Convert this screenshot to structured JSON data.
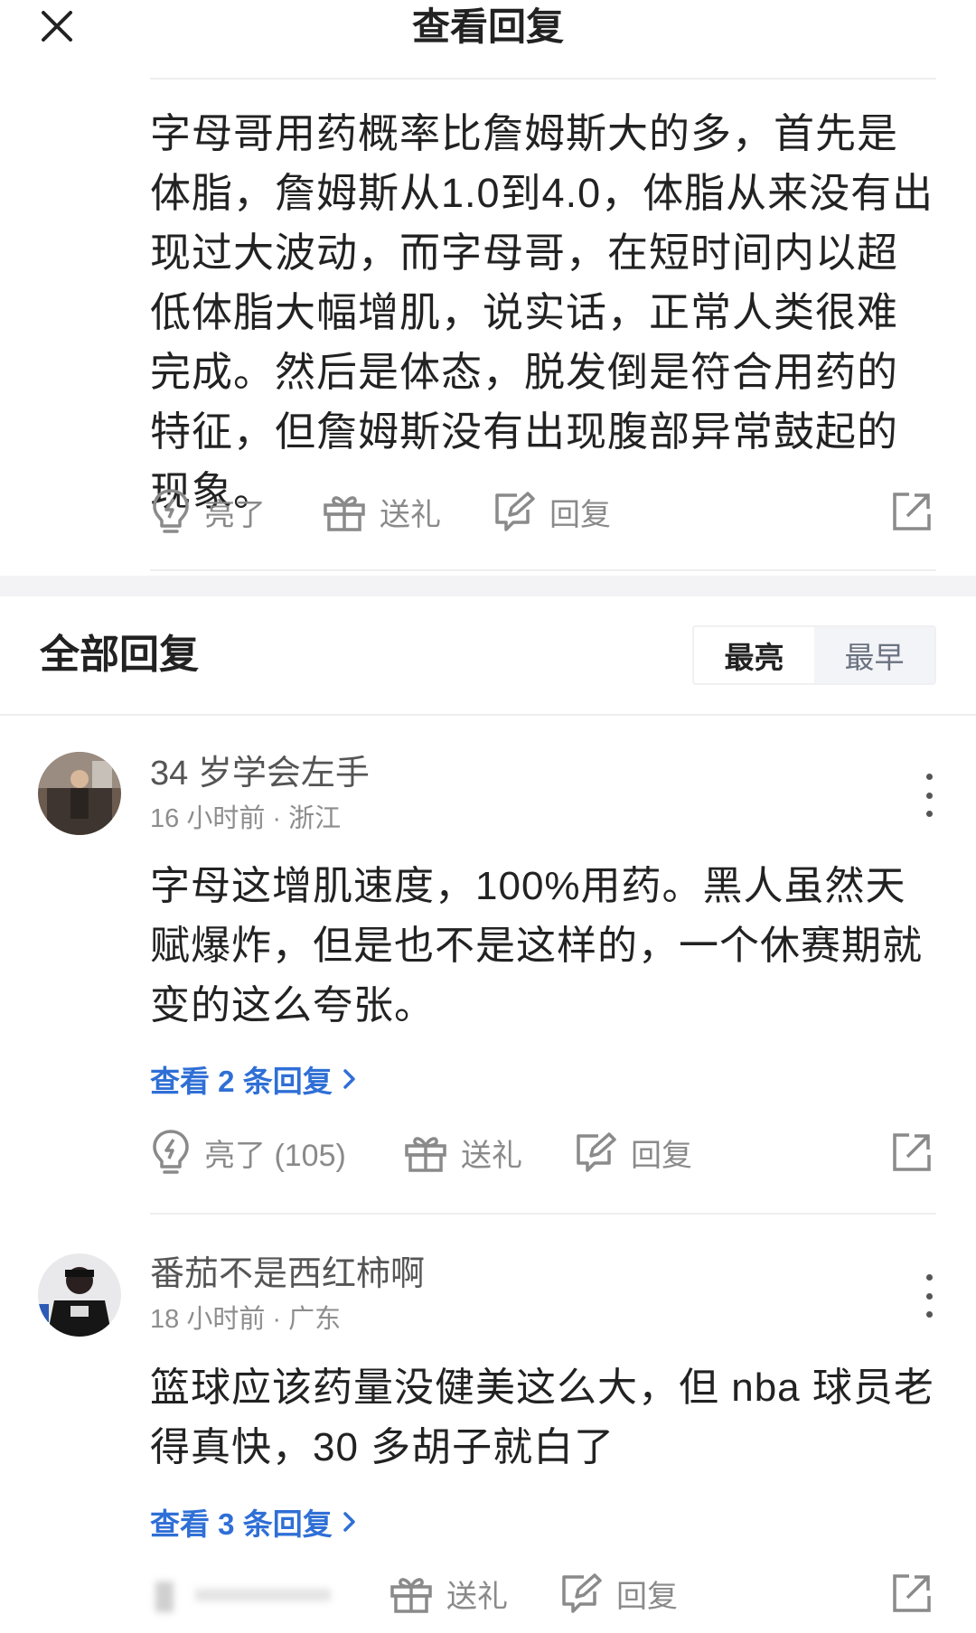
{
  "header": {
    "title": "查看回复"
  },
  "original": {
    "text": "字母哥用药概率比詹姆斯大的多，首先是体脂，詹姆斯从1.0到4.0，体脂从来没有出现过大波动，而字母哥，在短时间内以超低体脂大幅增肌，说实话，正常人类很难完成。然后是体态，脱发倒是符合用药的特征，但詹姆斯没有出现腹部异常鼓起的现象。",
    "actions": {
      "like": "亮了",
      "gift": "送礼",
      "reply": "回复"
    }
  },
  "replies_section": {
    "title": "全部回复",
    "sort": {
      "hottest": "最亮",
      "earliest": "最早"
    }
  },
  "comments": [
    {
      "username": "34 岁学会左手",
      "meta": "16 小时前 · 浙江",
      "text": "字母这增肌速度，100%用药。黑人虽然天赋爆炸，但是也不是这样的，一个休赛期就变的这么夸张。",
      "view_replies": "查看 2 条回复",
      "like": "亮了 (105)",
      "gift": "送礼",
      "reply": "回复"
    },
    {
      "username": "番茄不是西红柿啊",
      "meta": "18 小时前 · 广东",
      "text": "篮球应该药量没健美这么大，但 nba 球员老得真快，30 多胡子就白了",
      "view_replies": "查看 3 条回复",
      "gift": "送礼",
      "reply": "回复"
    }
  ],
  "colors": {
    "link": "#2f6fd6",
    "icon": "#8a8a8a",
    "section_gap": "#f3f3f5"
  }
}
